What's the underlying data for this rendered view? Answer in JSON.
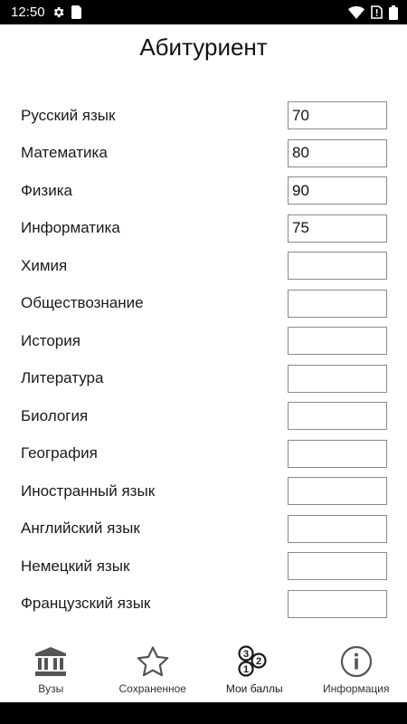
{
  "status_bar": {
    "time": "12:50",
    "icons": [
      "settings-icon",
      "sim-card-icon",
      "wifi-icon",
      "no-sim-icon",
      "battery-icon"
    ]
  },
  "header": {
    "title": "Абитуриент"
  },
  "subjects": [
    {
      "label": "Русский язык",
      "value": "70"
    },
    {
      "label": "Математика",
      "value": "80"
    },
    {
      "label": "Физика",
      "value": "90"
    },
    {
      "label": "Информатика",
      "value": "75"
    },
    {
      "label": "Химия",
      "value": ""
    },
    {
      "label": "Обществознание",
      "value": ""
    },
    {
      "label": "История",
      "value": ""
    },
    {
      "label": "Литература",
      "value": ""
    },
    {
      "label": "Биология",
      "value": ""
    },
    {
      "label": "География",
      "value": ""
    },
    {
      "label": "Иностранный язык",
      "value": ""
    },
    {
      "label": "Английский язык",
      "value": ""
    },
    {
      "label": "Немецкий язык",
      "value": ""
    },
    {
      "label": "Французский язык",
      "value": ""
    }
  ],
  "bottom_nav": [
    {
      "label": "Вузы",
      "icon": "university-icon"
    },
    {
      "label": "Сохраненное",
      "icon": "star-icon"
    },
    {
      "label": "Мои баллы",
      "icon": "scores-icon",
      "active": true,
      "icon_digits": [
        "3",
        "2",
        "1"
      ]
    },
    {
      "label": "Информация",
      "icon": "info-icon"
    }
  ],
  "colors": {
    "icon": "#555555",
    "active_icon": "#1a1a1a",
    "input_border": "#8a8a8a"
  }
}
